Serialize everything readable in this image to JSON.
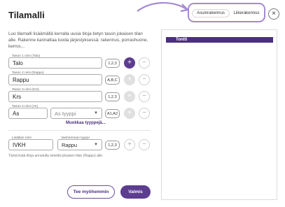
{
  "dialog": {
    "title": "Tilamalli",
    "close_glyph": "×",
    "description": "Luo tilamalli lisäämällä kerralla uusia tiloja tietyn tason jokaisen tilan alle. Rakenne kannattaa luoda järjestyksessä: rakennus, porrashuone, kerros..."
  },
  "segmented": {
    "active_label": "Asuinrakennus",
    "other_label": "Liikerakennus"
  },
  "levels": [
    {
      "label": "Tason 1 nimi (Talo)",
      "value": "Talo",
      "tag": "1,2,3"
    },
    {
      "label": "Tason 2 nimi (Rappu)",
      "value": "Rappu",
      "tag": "A,B,C"
    },
    {
      "label": "Tason 3 nimi (Krs)",
      "value": "Krs",
      "tag": "1,2,3"
    },
    {
      "label": "Tason 4 nimi (As)",
      "value": "As",
      "type_placeholder": "As tyyppi",
      "tag": "A1,A2"
    }
  ],
  "edit_types_link": "Muokkaa tyyppejä...",
  "extra": {
    "name_label": "Lisätilan nimi",
    "name_value": "IVKH",
    "parent_label": "Vanhemman tyyppi",
    "parent_value": "Rappu",
    "tag": "1,2,3"
  },
  "note": "Tämä lisää tiloja annetulla nimellä jokaisen tilan (Rappu) alle.",
  "buttons": {
    "later": "Tee myöhemmin",
    "done": "Valmis"
  },
  "tree": {
    "root_label": "Tontti"
  },
  "icons": {
    "plus": "+",
    "minus": "−",
    "caret": "▼"
  },
  "colors": {
    "accent": "#5c3d8f",
    "annotation": "#a58ad0"
  }
}
